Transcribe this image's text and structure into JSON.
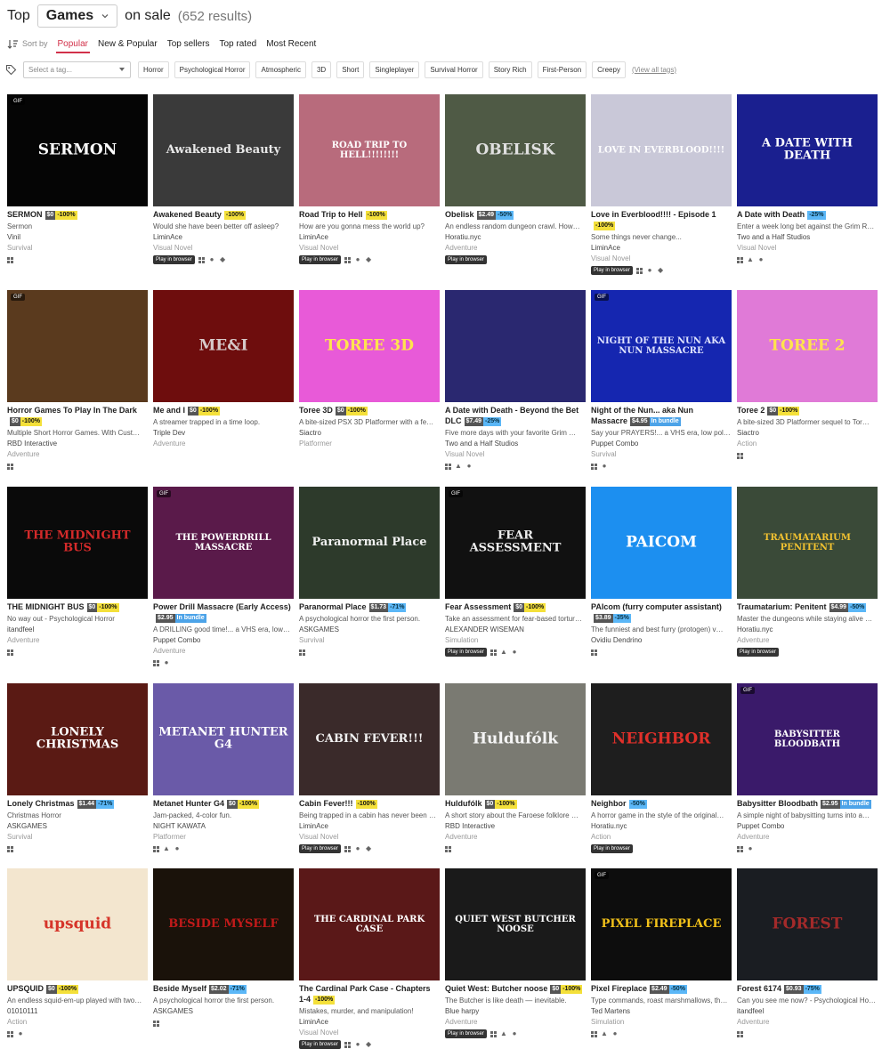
{
  "header": {
    "word1": "Top",
    "type_value": "Games",
    "word2": "on sale",
    "count": "(652 results)"
  },
  "sort": {
    "label": "Sort by",
    "options": [
      "Popular",
      "New & Popular",
      "Top sellers",
      "Top rated",
      "Most Recent"
    ],
    "active": "Popular"
  },
  "tags": {
    "placeholder": "Select a tag...",
    "chips": [
      "Horror",
      "Psychological Horror",
      "Atmospheric",
      "3D",
      "Short",
      "Singleplayer",
      "Survival Horror",
      "Story Rich",
      "First-Person",
      "Creepy"
    ],
    "view_all": "(View all tags)"
  },
  "games": [
    {
      "title": "SERMON",
      "price": "$0",
      "discount": "-100%",
      "desc": "Sermon",
      "author": "Vinil",
      "genre": "Survival",
      "gif": true,
      "browser": false,
      "platforms": [
        "windows"
      ],
      "cover_text": "SERMON",
      "cover_bg": "#050505",
      "cover_fg": "#ffffff"
    },
    {
      "title": "Awakened Beauty",
      "price": "",
      "discount": "-100%",
      "desc": "Would she have been better off asleep?",
      "author": "LiminAce",
      "genre": "Visual Novel",
      "gif": false,
      "browser": true,
      "platforms": [
        "windows",
        "mac",
        "android"
      ],
      "cover_text": "Awakened Beauty",
      "cover_bg": "#3a3a3a",
      "cover_fg": "#e8e8e8"
    },
    {
      "title": "Road Trip to Hell",
      "price": "",
      "discount": "-100%",
      "desc": "How are you gonna mess the world up?",
      "author": "LiminAce",
      "genre": "Visual Novel",
      "gif": false,
      "browser": true,
      "platforms": [
        "windows",
        "mac",
        "android"
      ],
      "cover_text": "ROAD TRIP TO HELL!!!!!!!!",
      "cover_bg": "#b86b7c",
      "cover_fg": "#ffffff"
    },
    {
      "title": "Obelisk",
      "price": "$2.49",
      "discount": "-50%",
      "desc": "An endless random dungeon crawl. How…",
      "author": "Horatiu.nyc",
      "genre": "Adventure",
      "gif": false,
      "browser": true,
      "platforms": [],
      "cover_text": "OBELISK",
      "cover_bg": "#4f5a45",
      "cover_fg": "#e0e0e0"
    },
    {
      "title": "Love in Everblood!!!! - Episode 1",
      "price": "",
      "discount": "-100%",
      "desc": "Some things never change...",
      "author": "LiminAce",
      "genre": "Visual Novel",
      "gif": false,
      "browser": true,
      "platforms": [
        "windows",
        "mac",
        "android"
      ],
      "cover_text": "LOVE IN EVERBLOOD!!!!",
      "cover_bg": "#c9c8d8",
      "cover_fg": "#ffffff"
    },
    {
      "title": "A Date with Death",
      "price": "",
      "discount": "-25%",
      "desc": "Enter a week long bet against the Grim R…",
      "author": "Two and a Half Studios",
      "genre": "Visual Novel",
      "gif": false,
      "browser": false,
      "platforms": [
        "windows",
        "linux",
        "mac"
      ],
      "cover_text": "A DATE WITH DEATH",
      "cover_bg": "#1a1f8f",
      "cover_fg": "#ffffff"
    },
    {
      "title": "Horror Games To Play In The Dark",
      "price": "$0",
      "discount": "-100%",
      "desc": "Multiple Short Horror Games. With Cust…",
      "author": "RBD Interactive",
      "genre": "Adventure",
      "gif": true,
      "browser": false,
      "platforms": [
        "windows"
      ],
      "cover_text": "",
      "cover_bg": "#5a3a1e",
      "cover_fg": "#ffffff"
    },
    {
      "title": "Me and I",
      "price": "$0",
      "discount": "-100%",
      "desc": "A streamer trapped in a time loop.",
      "author": "Triple Dev",
      "genre": "Adventure",
      "gif": false,
      "browser": false,
      "platforms": [],
      "cover_text": "ME&I",
      "cover_bg": "#6e0d0d",
      "cover_fg": "#d7c9c9"
    },
    {
      "title": "Toree 3D",
      "price": "$0",
      "discount": "-100%",
      "desc": "A bite-sized PSX 3D Platformer with a fe…",
      "author": "Siactro",
      "genre": "Platformer",
      "gif": false,
      "browser": false,
      "platforms": [],
      "cover_text": "TOREE 3D",
      "cover_bg": "#e85ad8",
      "cover_fg": "#ffe44d"
    },
    {
      "title": "A Date with Death - Beyond the Bet DLC",
      "price": "$7.49",
      "discount": "-25%",
      "desc": "Five more days with your favorite Grim …",
      "author": "Two and a Half Studios",
      "genre": "Visual Novel",
      "gif": false,
      "browser": false,
      "platforms": [
        "windows",
        "linux",
        "mac"
      ],
      "cover_text": "",
      "cover_bg": "#2a2870",
      "cover_fg": "#ffffff"
    },
    {
      "title": "Night of the Nun... aka Nun Massacre",
      "price": "$4.95",
      "discount": "",
      "bundle": "In bundle",
      "desc": "Say your PRAYERS!... a VHS era, low pol…",
      "author": "Puppet Combo",
      "genre": "Survival",
      "gif": true,
      "browser": false,
      "platforms": [
        "windows",
        "mac"
      ],
      "cover_text": "NIGHT OF THE NUN AKA NUN MASSACRE",
      "cover_bg": "#1526b0",
      "cover_fg": "#dfe3ff"
    },
    {
      "title": "Toree 2",
      "price": "$0",
      "discount": "-100%",
      "desc": "A bite-sized 3D Platformer sequel to Tor…",
      "author": "Siactro",
      "genre": "Action",
      "gif": false,
      "browser": false,
      "platforms": [
        "windows"
      ],
      "cover_text": "TOREE 2",
      "cover_bg": "#e07ad7",
      "cover_fg": "#ffe44d"
    },
    {
      "title": "THE MIDNIGHT BUS",
      "price": "$0",
      "discount": "-100%",
      "desc": "No way out - Psychological Horror",
      "author": "itandfeel",
      "genre": "Adventure",
      "gif": false,
      "browser": false,
      "platforms": [
        "windows"
      ],
      "cover_text": "THE MIDNIGHT BUS",
      "cover_bg": "#0a0a0a",
      "cover_fg": "#d42a2a"
    },
    {
      "title": "Power Drill Massacre (Early Access)",
      "price": "$2.95",
      "discount": "",
      "bundle": "In bundle",
      "desc": "A DRILLING good time!... a VHS era, low…",
      "author": "Puppet Combo",
      "genre": "Adventure",
      "gif": true,
      "browser": false,
      "platforms": [
        "windows",
        "mac"
      ],
      "cover_text": "THE POWERDRILL MASSACRE",
      "cover_bg": "#5a1a4a",
      "cover_fg": "#ffffff"
    },
    {
      "title": "Paranormal Place",
      "price": "$1.73",
      "discount": "-71%",
      "desc": "A psychological horror the first person.",
      "author": "ASKGAMES",
      "genre": "Survival",
      "gif": false,
      "browser": false,
      "platforms": [
        "windows"
      ],
      "cover_text": "Paranormal Place",
      "cover_bg": "#2d3a2b",
      "cover_fg": "#f0f0f0"
    },
    {
      "title": "Fear Assessment",
      "price": "$0",
      "discount": "-100%",
      "desc": "Take an assessment for fear-based tortur…",
      "author": "ALEXANDER WISEMAN",
      "genre": "Simulation",
      "gif": true,
      "browser": true,
      "platforms": [
        "windows",
        "linux",
        "mac"
      ],
      "cover_text": "FEAR ASSESSMENT",
      "cover_bg": "#111111",
      "cover_fg": "#eeeeee"
    },
    {
      "title": "PAIcom (furry computer assistant)",
      "price": "$3.89",
      "discount": "-35%",
      "desc": "The funniest and best furry (protogen) v…",
      "author": "Ovidiu Dendrino",
      "genre": "",
      "gif": false,
      "browser": false,
      "platforms": [
        "windows"
      ],
      "cover_text": "PAICOM",
      "cover_bg": "#1c8ff0",
      "cover_fg": "#ffffff"
    },
    {
      "title": "Traumatarium: Penitent",
      "price": "$4.99",
      "discount": "-50%",
      "desc": "Master the dungeons while staying alive …",
      "author": "Horatiu.nyc",
      "genre": "Adventure",
      "gif": false,
      "browser": true,
      "platforms": [],
      "cover_text": "TRAUMATARIUM PENITENT",
      "cover_bg": "#3a4a38",
      "cover_fg": "#f2c230"
    },
    {
      "title": "Lonely Christmas",
      "price": "$1.44",
      "discount": "-71%",
      "desc": "Christmas Horror",
      "author": "ASKGAMES",
      "genre": "Survival",
      "gif": false,
      "browser": false,
      "platforms": [
        "windows"
      ],
      "cover_text": "LONELY CHRISTMAS",
      "cover_bg": "#5a1a14",
      "cover_fg": "#ffffff"
    },
    {
      "title": "Metanet Hunter G4",
      "price": "$0",
      "discount": "-100%",
      "desc": "Jam-packed, 4-color fun.",
      "author": "NIGHT KAWATA",
      "genre": "Platformer",
      "gif": false,
      "browser": false,
      "platforms": [
        "windows",
        "linux",
        "mac"
      ],
      "cover_text": "METANET HUNTER G4",
      "cover_bg": "#6a5aa8",
      "cover_fg": "#ffffff"
    },
    {
      "title": "Cabin Fever!!!",
      "price": "",
      "discount": "-100%",
      "desc": "Being trapped in a cabin has never been …",
      "author": "LiminAce",
      "genre": "Visual Novel",
      "gif": false,
      "browser": true,
      "platforms": [
        "windows",
        "mac",
        "android"
      ],
      "cover_text": "CABIN FEVER!!!",
      "cover_bg": "#3a2a2a",
      "cover_fg": "#f0f0f0"
    },
    {
      "title": "Huldufólk",
      "price": "$0",
      "discount": "-100%",
      "desc": "A short story about the Faroese folklore …",
      "author": "RBD Interactive",
      "genre": "Adventure",
      "gif": false,
      "browser": false,
      "platforms": [
        "windows"
      ],
      "cover_text": "Huldufólk",
      "cover_bg": "#7a7a72",
      "cover_fg": "#f5f5f5"
    },
    {
      "title": "Neighbor",
      "price": "",
      "discount": "-50%",
      "desc": "A horror game in the style of the original…",
      "author": "Horatiu.nyc",
      "genre": "Action",
      "gif": false,
      "browser": true,
      "platforms": [],
      "cover_text": "NEIGHBOR",
      "cover_bg": "#1e1e1e",
      "cover_fg": "#e0302a"
    },
    {
      "title": "Babysitter Bloodbath",
      "price": "$2.95",
      "discount": "",
      "bundle": "In bundle",
      "desc": "A simple night of babysitting turns into a…",
      "author": "Puppet Combo",
      "genre": "Adventure",
      "gif": true,
      "browser": false,
      "platforms": [
        "windows",
        "mac"
      ],
      "cover_text": "BABYSITTER BLOODBATH",
      "cover_bg": "#3a1a6a",
      "cover_fg": "#ffffff"
    },
    {
      "title": "UPSQUID",
      "price": "$0",
      "discount": "-100%",
      "desc": "An endless squid-em-up played with two…",
      "author": "01010111",
      "genre": "Action",
      "gif": false,
      "browser": false,
      "platforms": [
        "windows",
        "mac"
      ],
      "cover_text": "upsquid",
      "cover_bg": "#f3e6cf",
      "cover_fg": "#d6352a"
    },
    {
      "title": "Beside Myself",
      "price": "$2.02",
      "discount": "-71%",
      "desc": "A psychological horror the first person.",
      "author": "ASKGAMES",
      "genre": "",
      "gif": false,
      "browser": false,
      "platforms": [
        "windows"
      ],
      "cover_text": "BESIDE MYSELF",
      "cover_bg": "#1a120a",
      "cover_fg": "#c21a1a"
    },
    {
      "title": "The Cardinal Park Case - Chapters 1-4",
      "price": "",
      "discount": "-100%",
      "desc": "Mistakes, murder, and manipulation!",
      "author": "LiminAce",
      "genre": "Visual Novel",
      "gif": false,
      "browser": true,
      "platforms": [
        "windows",
        "mac",
        "android"
      ],
      "cover_text": "THE CARDINAL PARK CASE",
      "cover_bg": "#5a1818",
      "cover_fg": "#ffffff"
    },
    {
      "title": "Quiet West: Butcher noose",
      "price": "$0",
      "discount": "-100%",
      "desc": "The Butcher is like death — inevitable.",
      "author": "Blue harpy",
      "genre": "Adventure",
      "gif": false,
      "browser": true,
      "platforms": [
        "windows",
        "linux",
        "mac"
      ],
      "cover_text": "QUIET WEST BUTCHER NOOSE",
      "cover_bg": "#1a1a1a",
      "cover_fg": "#ffffff"
    },
    {
      "title": "Pixel Fireplace",
      "price": "$2.49",
      "discount": "-50%",
      "desc": "Type commands, roast marshmallows, th…",
      "author": "Ted Martens",
      "genre": "Simulation",
      "gif": true,
      "browser": false,
      "platforms": [
        "windows",
        "linux",
        "mac"
      ],
      "cover_text": "PIXEL FIREPLACE",
      "cover_bg": "#0d0d0d",
      "cover_fg": "#f3c21a"
    },
    {
      "title": "Forest 6174",
      "price": "$0.93",
      "discount": "-75%",
      "desc": "Can you see me now? - Psychological Ho…",
      "author": "itandfeel",
      "genre": "Adventure",
      "gif": false,
      "browser": false,
      "platforms": [
        "windows"
      ],
      "cover_text": "FOREST",
      "cover_bg": "#1a1d22",
      "cover_fg": "#a32a2a"
    }
  ]
}
